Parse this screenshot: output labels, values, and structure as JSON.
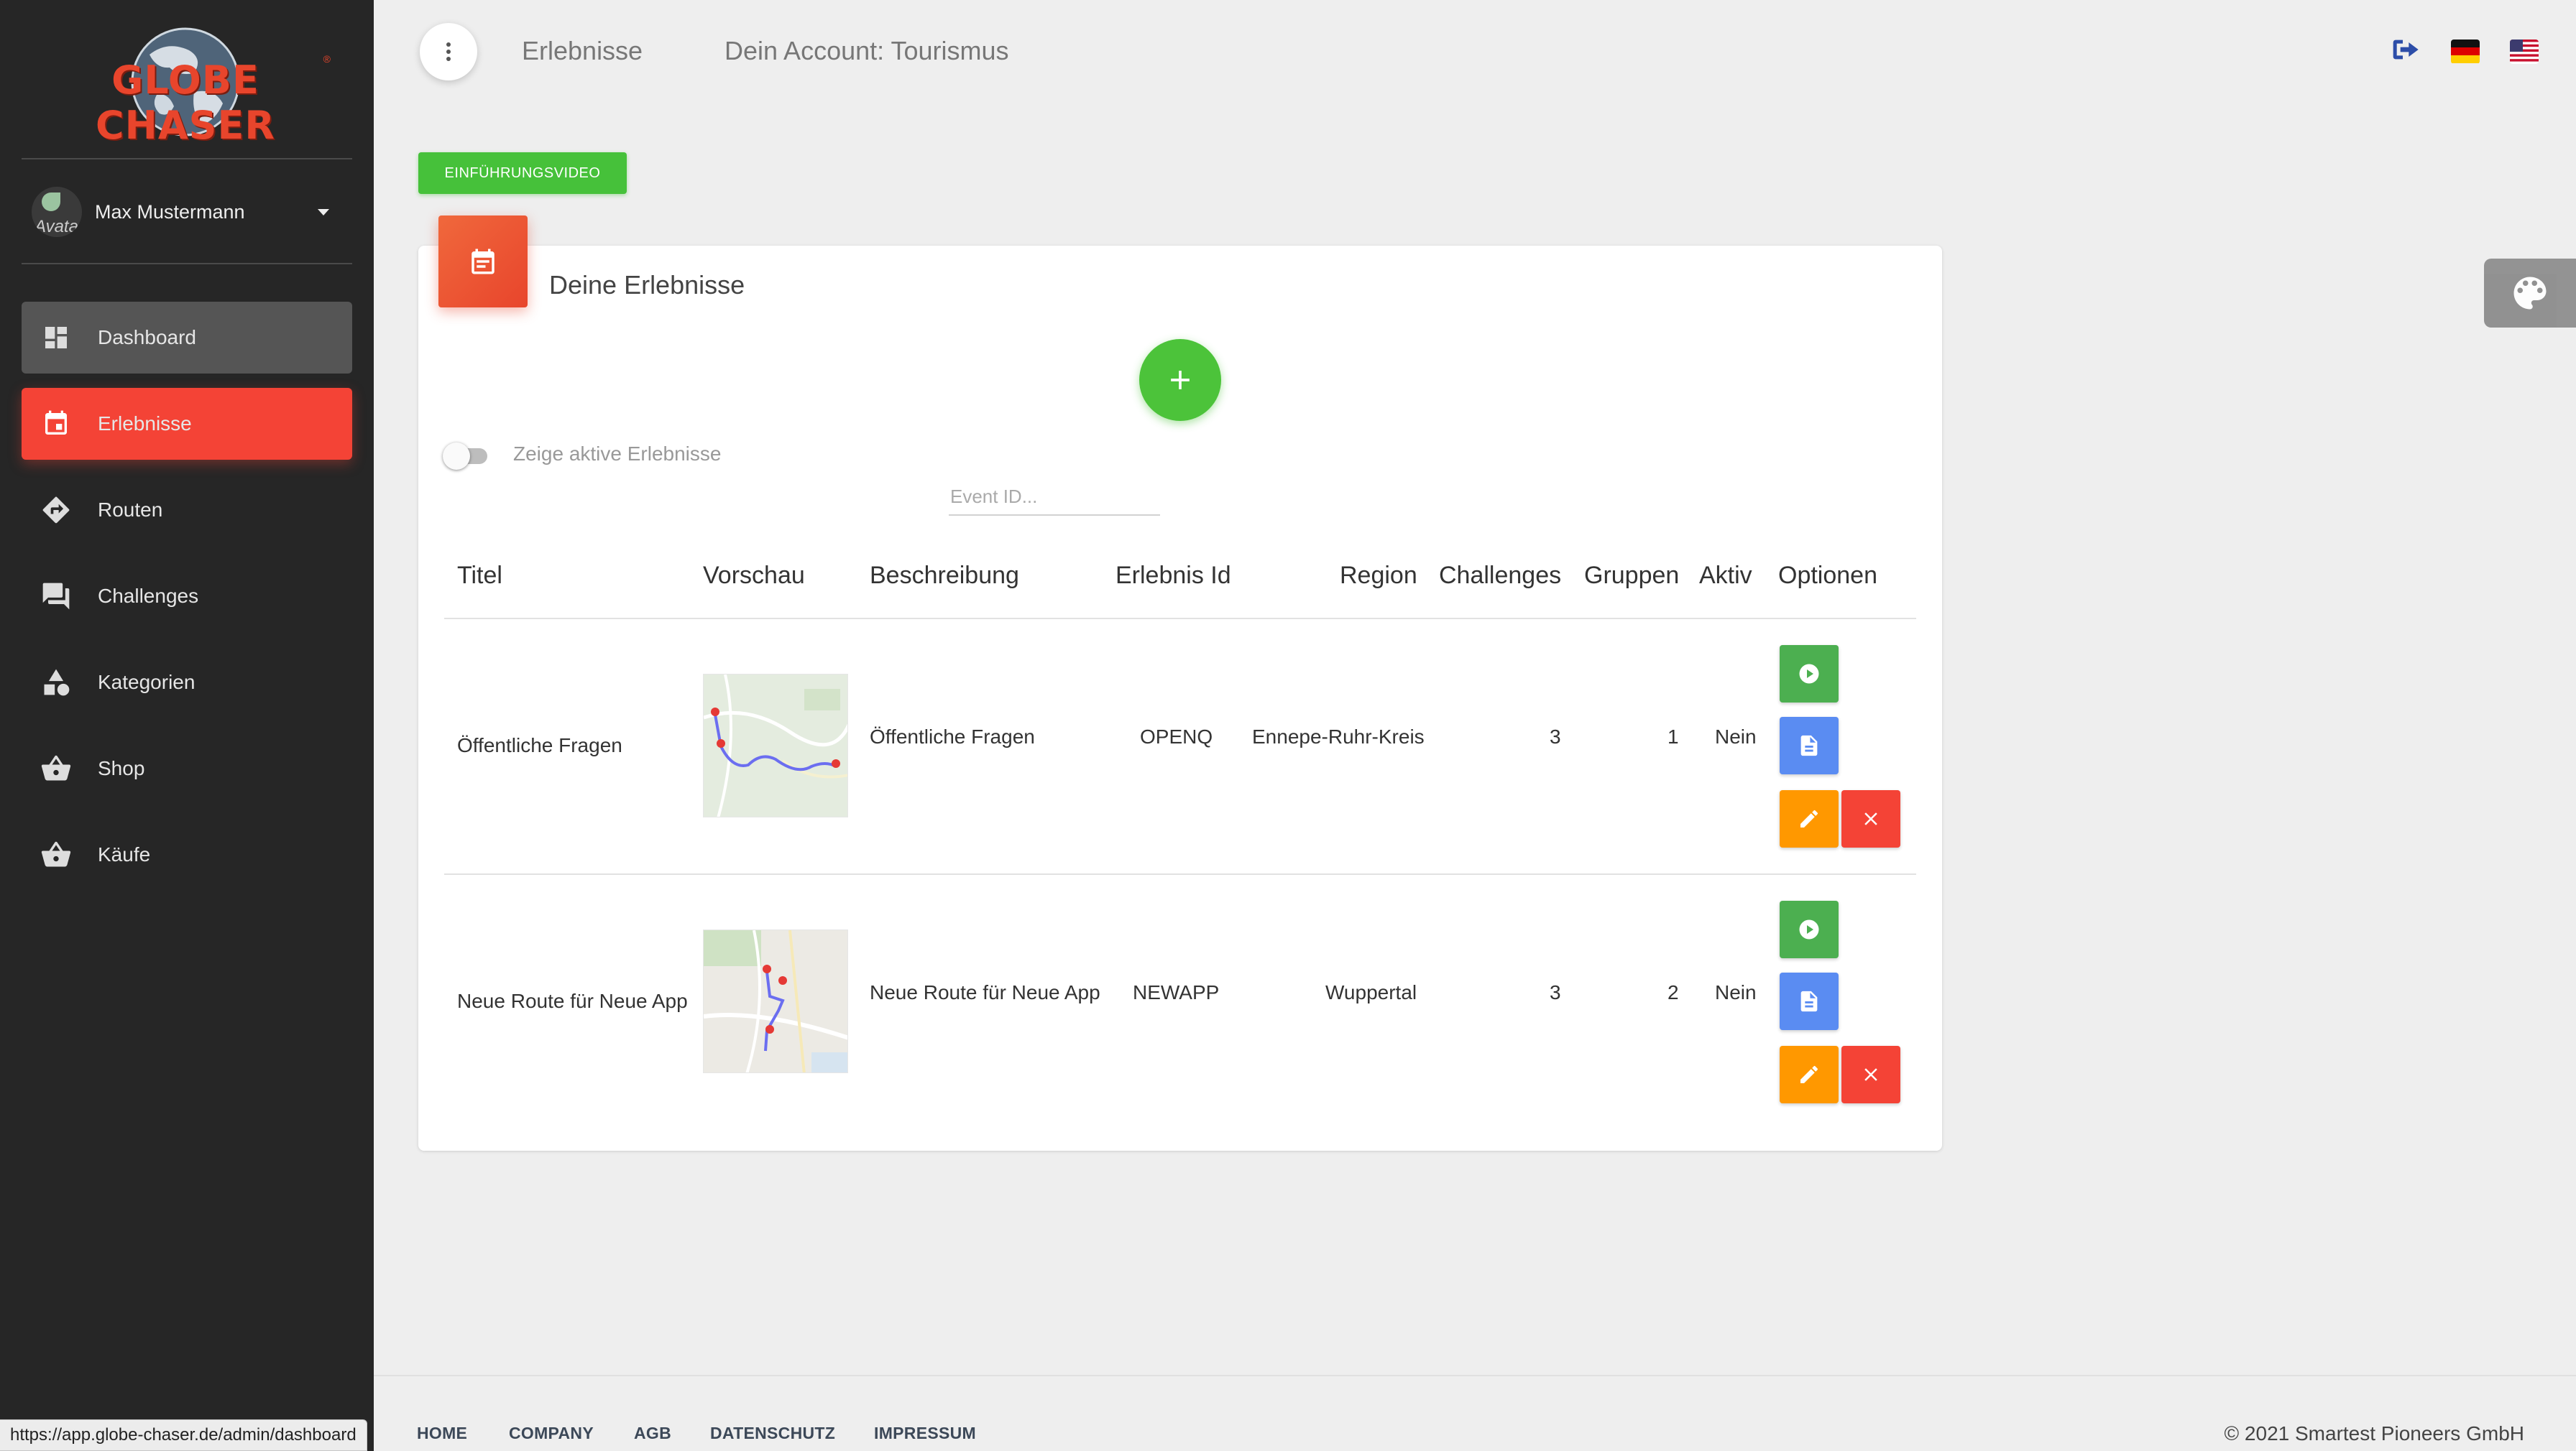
{
  "brand": {
    "logo_text": "GLOBE CHASER",
    "logo_reg": "®"
  },
  "user": {
    "avatar_alt": "Avatar",
    "name": "Max Mustermann"
  },
  "nav": {
    "items": [
      {
        "label": "Dashboard",
        "icon": "dashboard-icon"
      },
      {
        "label": "Erlebnisse",
        "icon": "calendar-icon"
      },
      {
        "label": "Routen",
        "icon": "directions-icon"
      },
      {
        "label": "Challenges",
        "icon": "chat-icon"
      },
      {
        "label": "Kategorien",
        "icon": "category-icon"
      },
      {
        "label": "Shop",
        "icon": "basket-icon"
      },
      {
        "label": "Käufe",
        "icon": "basket-icon"
      }
    ],
    "active": "Erlebnisse"
  },
  "topbar": {
    "page_title": "Erlebnisse",
    "account_label": "Dein Account: Tourismus",
    "icons": [
      "logout-icon",
      "flag-de-icon",
      "flag-us-icon"
    ]
  },
  "intro_button": "EINFÜHRUNGSVIDEO",
  "card": {
    "title": "Deine Erlebnisse",
    "toggle_label": "Zeige aktive Erlebnisse",
    "toggle_on": false,
    "event_input_placeholder": "Event ID..."
  },
  "table": {
    "headers": [
      "Titel",
      "Vorschau",
      "Beschreibung",
      "Erlebnis Id",
      "Region",
      "Challenges",
      "Gruppen",
      "Aktiv",
      "Optionen"
    ],
    "rows": [
      {
        "title": "Öffentliche Fragen",
        "description": "Öffentliche Fragen",
        "id": "OPENQ",
        "region": "Ennepe-Ruhr-Kreis",
        "challenges": "3",
        "groups": "1",
        "active": "Nein"
      },
      {
        "title": "Neue Route für Neue App",
        "description": "Neue Route für Neue App",
        "id": "NEWAPP",
        "region": "Wuppertal",
        "challenges": "3",
        "groups": "2",
        "active": "Nein"
      }
    ]
  },
  "footer": {
    "links": [
      "HOME",
      "COMPANY",
      "AGB",
      "DATENSCHUTZ",
      "IMPRESSUM"
    ],
    "copyright": "© 2021 Smartest Pioneers GmbH"
  },
  "status_url": "https://app.globe-chaser.de/admin/dashboard",
  "colors": {
    "sidebar": "#262626",
    "active": "#f44336",
    "accent_green": "#4cc33a",
    "blue": "#5a8cf2",
    "orange": "#ff9800"
  }
}
